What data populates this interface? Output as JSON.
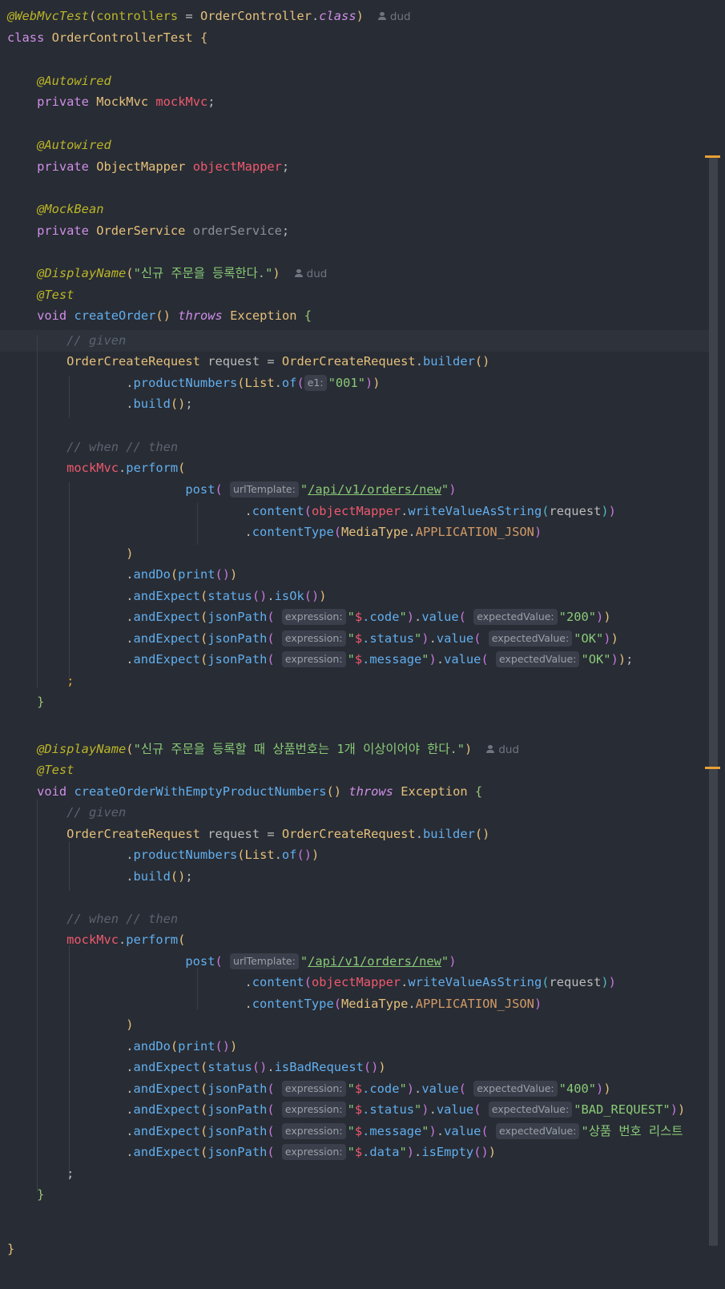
{
  "author": "dud",
  "hints": {
    "e1": "e1:",
    "urlTemplate": "urlTemplate:",
    "expression": "expression:",
    "expectedValue": "expectedValue:"
  },
  "code": {
    "annotation_class": "@WebMvcTest",
    "controllers_attr": "controllers",
    "order_controller": "OrderController",
    "class_kw": "class",
    "test_class_name": "OrderControllerTest",
    "autowired": "@Autowired",
    "mock_bean": "@MockBean",
    "private_kw": "private",
    "mock_mvc_type": "MockMvc",
    "mock_mvc_field": "mockMvc",
    "object_mapper_type": "ObjectMapper",
    "object_mapper_field": "objectMapper",
    "order_service_type": "OrderService",
    "order_service_field": "orderService",
    "display_name": "@DisplayName",
    "test_annotation": "@Test",
    "void_kw": "void",
    "throws_kw": "throws",
    "exception_type": "Exception",
    "comment_given": "// given",
    "comment_when_then": "// when // then",
    "request_type": "OrderCreateRequest",
    "request_var": "request",
    "builder_call": "builder",
    "product_numbers": "productNumbers",
    "list_type": "List",
    "of_call": "of",
    "build_call": "build",
    "perform_call": "perform",
    "post_call": "post",
    "url": "/api/v1/orders/new",
    "content_call": "content",
    "write_value_as_string": "writeValueAsString",
    "content_type_call": "contentType",
    "media_type": "MediaType",
    "application_json": "APPLICATION_JSON",
    "and_do": "andDo",
    "print_call": "print",
    "and_expect": "andExpect",
    "status_call": "status",
    "json_path": "jsonPath",
    "value_call": "value",
    "is_ok": "isOk",
    "is_bad_request": "isBadRequest",
    "is_empty": "isEmpty",
    "dollar": "$",
    "path_code": ".code",
    "path_status": ".status",
    "path_message": ".message",
    "path_data": ".data"
  },
  "tests": [
    {
      "display_name": "신규 주문을 등록한다.",
      "method": "createOrder",
      "product_number": "001",
      "status_check": "isOk",
      "expected_code": "200",
      "expected_status": "OK",
      "expected_message": "OK"
    },
    {
      "display_name": "신규 주문을 등록할 때 상품번호는 1개 이상이어야 한다.",
      "method": "createOrderWithEmptyProductNumbers",
      "status_check": "isBadRequest",
      "expected_code": "400",
      "expected_status": "BAD_REQUEST",
      "expected_message_visible": "상품 번호 리스트"
    }
  ],
  "colors": {
    "background": "#282c34",
    "annotation": "#bbb529",
    "keyword": "#cf8ee8",
    "field": "#ef596f",
    "string": "#89ca78",
    "function": "#61afef",
    "class": "#e5c07b",
    "comment": "#5c6370",
    "error_stripe": "#e8a036"
  }
}
